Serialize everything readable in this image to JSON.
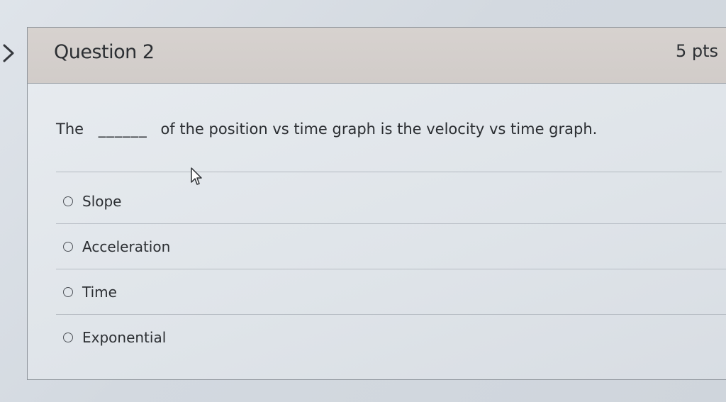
{
  "question": {
    "title": "Question 2",
    "points": "5 pts",
    "prompt_before": "The",
    "blank": "______",
    "prompt_after": "of the position vs time graph is the velocity vs time graph."
  },
  "answers": [
    {
      "label": "Slope"
    },
    {
      "label": "Acceleration"
    },
    {
      "label": "Time"
    },
    {
      "label": "Exponential"
    }
  ],
  "icons": {
    "left_arrow": "chevron-right-icon",
    "cursor": "mouse-pointer-icon",
    "radio": "radio-button-unselected"
  },
  "colors": {
    "header_bg": "#d4cfcc",
    "card_bg": "#e4e8ec",
    "text": "#2c2f33",
    "border": "#8e949b"
  }
}
